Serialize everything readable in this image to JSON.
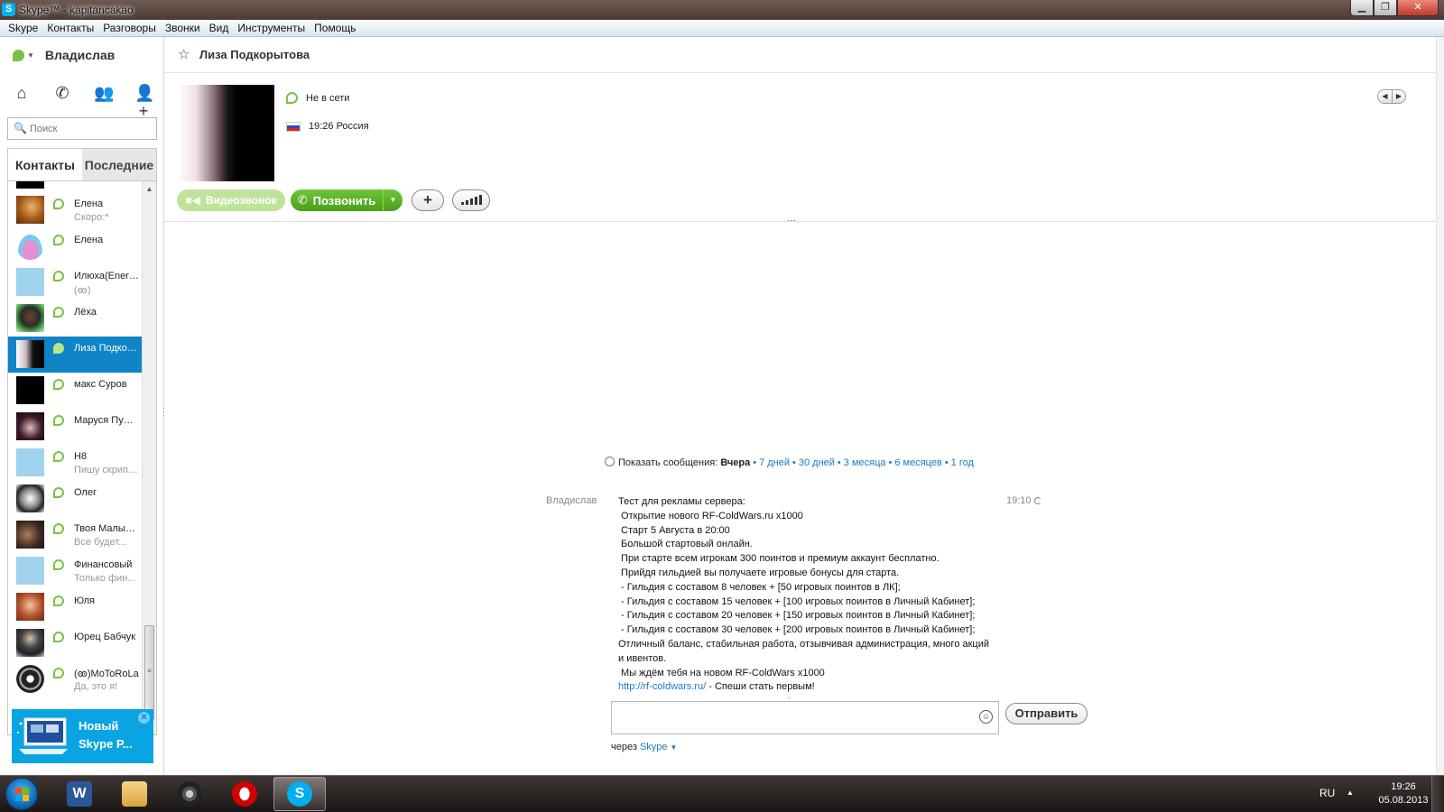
{
  "window": {
    "title": "Skype™ - kapitancakao",
    "min_label": "▁",
    "max_label": "❐",
    "close_label": "✕"
  },
  "menu": [
    "Skype",
    "Контакты",
    "Разговоры",
    "Звонки",
    "Вид",
    "Инструменты",
    "Помощь"
  ],
  "user": {
    "name": "Владислав"
  },
  "nav_icons": [
    "home-icon",
    "phone-icon",
    "group-icon",
    "add-contact-icon"
  ],
  "search": {
    "placeholder": "Поиск"
  },
  "tabs": {
    "contacts": "Контакты",
    "recent": "Последние"
  },
  "contacts": [
    {
      "name": "Елена",
      "mood": "Скоро:*"
    },
    {
      "name": "Елена",
      "mood": ""
    },
    {
      "name": "Илюха(Energy)",
      "mood": "(ꙭ)"
    },
    {
      "name": "Лёха",
      "mood": ""
    },
    {
      "name": "Лиза  Подкорытова",
      "mood": ""
    },
    {
      "name": "макс Суров",
      "mood": ""
    },
    {
      "name": "Маруся Пушкина",
      "mood": ""
    },
    {
      "name": "Н8",
      "mood": "Пишу скрипты"
    },
    {
      "name": "Олег",
      "mood": ""
    },
    {
      "name": "Твоя Малышка",
      "mood": "Все будет..."
    },
    {
      "name": "Финансовый",
      "mood": "Только фин..."
    },
    {
      "name": "Юля",
      "mood": ""
    },
    {
      "name": "Юрец Бабчук",
      "mood": ""
    },
    {
      "name": "(ꙭ)MoToRoLa",
      "mood": "Да, это я!"
    }
  ],
  "promo": {
    "line1": "Новый",
    "line2": "Skype P...",
    "close": "✕"
  },
  "conversation": {
    "contact_name": "Лиза  Подкорытова",
    "status": "Не в сети",
    "local_time": "19:26 Россия",
    "video_call": "Видеозвонок",
    "call": "Позвонить",
    "add": "+",
    "dots": "..."
  },
  "history": {
    "prefix": "Показать сообщения:",
    "current": "Вчера",
    "options": [
      "7 дней",
      "30 дней",
      "3 месяца",
      "6 месяцев",
      "1 год"
    ]
  },
  "message": {
    "sender": "Владислав",
    "time": "19:10",
    "lines": [
      "Тест для рекламы сервера:",
      " Открытие нового RF-ColdWars.ru x1000",
      " Старт 5 Августа в 20:00",
      " Большой стартовый онлайн.",
      " При старте всем игрокам 300 поинтов и премиум аккаунт бесплатно.",
      " Прийдя гильдией вы получаете игровые бонусы для старта.",
      " - Гильдия с составом 8 человек + [50 игровых поинтов в ЛК];",
      " - Гильдия с составом 15 человек + [100 игровых поинтов в Личный Кабинет];",
      " - Гильдия с составом 20 человек + [150 игровых поинтов в Личный Кабинет];",
      " - Гильдия с составом 30 человек + [200 игровых поинтов в Личный Кабинет];",
      " Отличный баланс, стабильная работа, отзывчивая администрация, много акций и ивентов.",
      " Мы ждём тебя на новом RF-ColdWars x1000"
    ],
    "link": "http://rf-coldwars.ru/",
    "link_suffix": " - Спеши стать первым!"
  },
  "composer": {
    "send": "Отправить",
    "via_prefix": "через",
    "via_app": "Skype"
  },
  "taskbar": {
    "apps": [
      "word-icon",
      "explorer-icon",
      "steam-icon",
      "opera-icon",
      "skype-icon"
    ],
    "lang": "RU",
    "time": "19:26",
    "date": "05.08.2013"
  }
}
